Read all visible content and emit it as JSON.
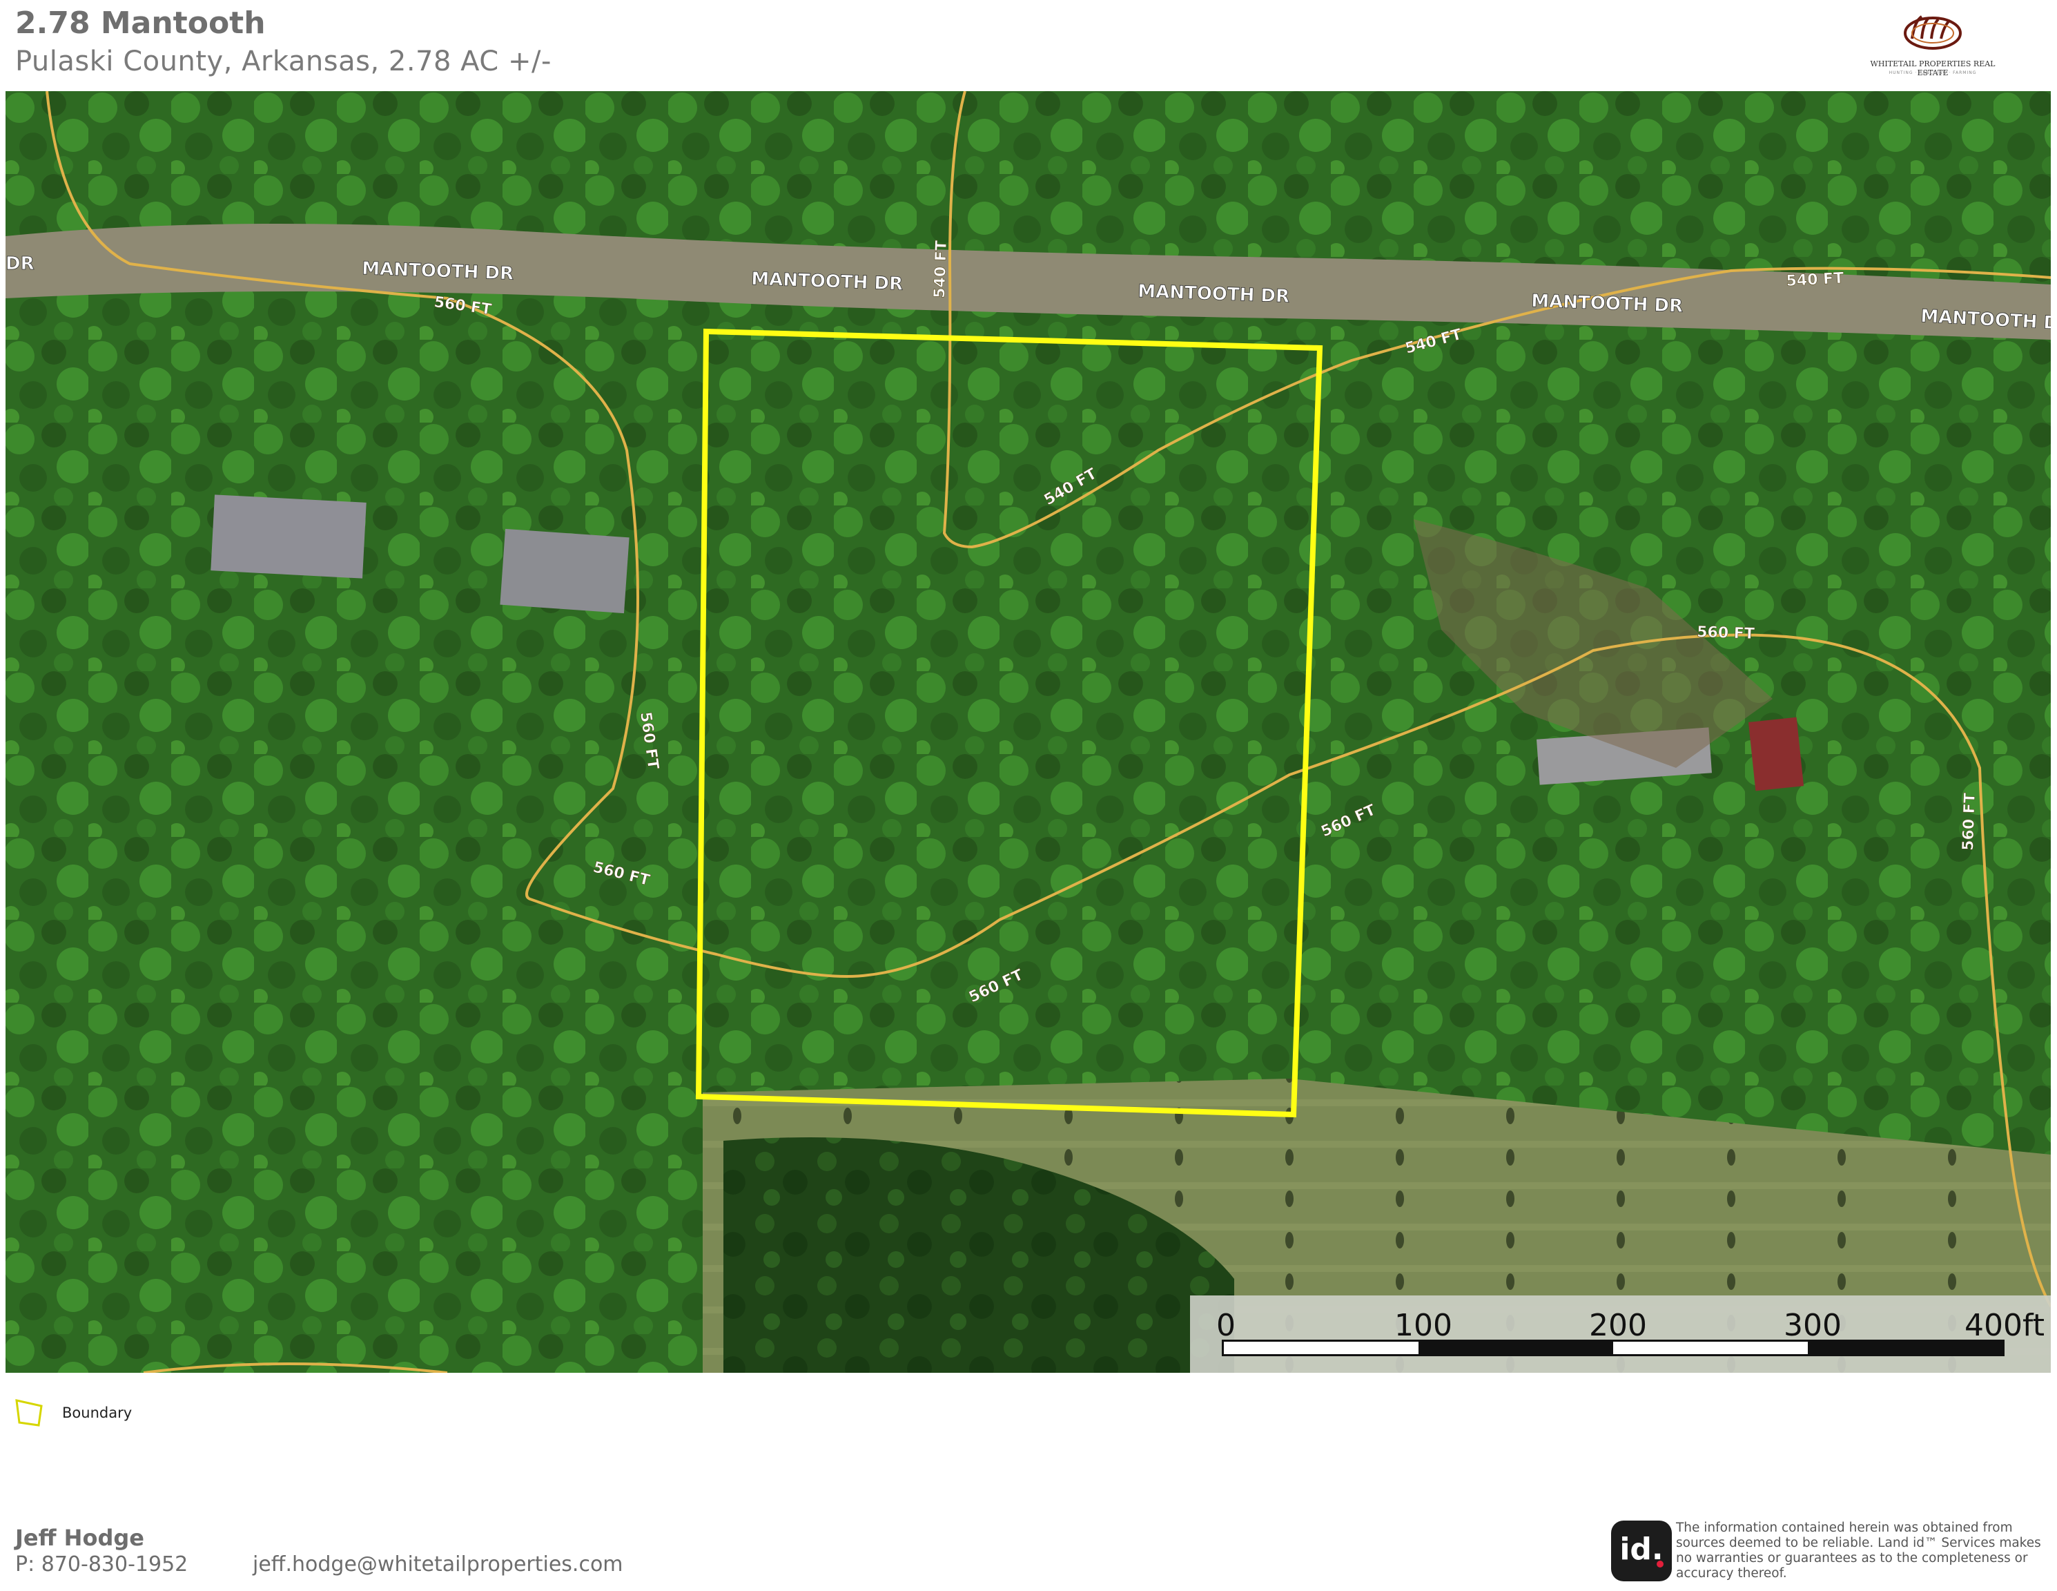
{
  "header": {
    "title": "2.78 Mantooth",
    "subtitle": "Pulaski County, Arkansas, 2.78 AC +/-"
  },
  "logo": {
    "brand": "WHITETAIL PROPERTIES REAL ESTATE",
    "tagline": "HUNTING · RANCHING · FARMING"
  },
  "map": {
    "road_labels": [
      "DR",
      "MANTOOTH DR",
      "MANTOOTH DR",
      "MANTOOTH DR",
      "MANTOOTH DR",
      "MANTOOTH DR"
    ],
    "contours": {
      "c560": "560 FT",
      "c540": "540 FT"
    },
    "boundary_color": "#ffff14",
    "road_color": "#e0b24a"
  },
  "scale_bar": {
    "ticks": [
      "0",
      "100",
      "200",
      "300",
      "400ft"
    ]
  },
  "legend": {
    "items": [
      {
        "label": "Boundary",
        "icon": "boundary-polygon-icon"
      }
    ]
  },
  "agent": {
    "name": "Jeff Hodge",
    "phone": "P: 870-830-1952",
    "email": "jeff.hodge@whitetailproperties.com"
  },
  "footer": {
    "id_logo": "id.",
    "disclaimer": "The information contained herein was obtained from sources deemed to be reliable. Land id™ Services makes no warranties or guarantees as to the completeness or accuracy thereof."
  }
}
